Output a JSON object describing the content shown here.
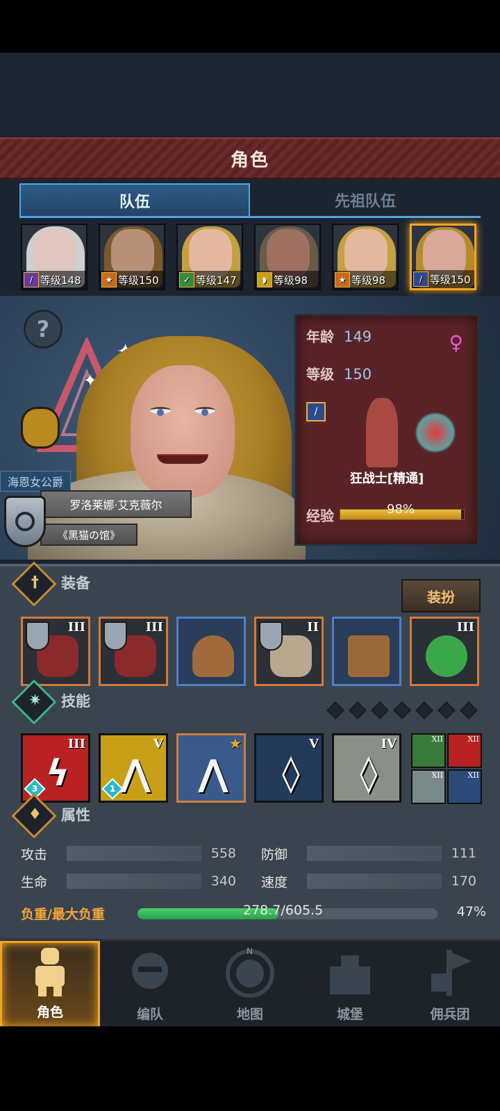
{
  "title": "角色",
  "tabs": {
    "party": "队伍",
    "ancestors": "先祖队伍"
  },
  "roster": [
    {
      "level": "等级148",
      "hair": "#cfcfcf",
      "skin": "#e0c6c0",
      "class_icon": "staff-icon",
      "class_color": "#6a3aa0"
    },
    {
      "level": "等级150",
      "hair": "#7a5a2a",
      "skin": "#b89078",
      "class_icon": "beast-icon",
      "class_color": "#c86a1a"
    },
    {
      "level": "等级147",
      "hair": "#c4a040",
      "skin": "#e4b8a0",
      "class_icon": "bow-icon",
      "class_color": "#3a8a3a"
    },
    {
      "level": "等级98",
      "hair": "#6a5a48",
      "skin": "#a07060",
      "class_icon": "shield-icon",
      "class_color": "#c8a018"
    },
    {
      "level": "等级98",
      "hair": "#c4a040",
      "skin": "#e4b8a0",
      "class_icon": "beast-icon",
      "class_color": "#c86a1a"
    },
    {
      "level": "等级150",
      "hair": "#b88a30",
      "skin": "#d8a898",
      "class_icon": "sword-icon",
      "class_color": "#2d4a8c"
    }
  ],
  "hero": {
    "title_tag": "海恩女公爵",
    "name": "罗洛莱娜·艾克薇尔",
    "guild": "《黑猫の馆》"
  },
  "info": {
    "age_label": "年龄",
    "age": "149",
    "level_label": "等级",
    "level": "150",
    "class_name": "狂战士[精通]",
    "exp_label": "经验",
    "exp_percent": "98%",
    "exp_fraction": 0.98
  },
  "equipment": {
    "label": "装备",
    "outfit_button": "装扮",
    "slots": [
      {
        "tier": "III",
        "border": "orange",
        "shield": true,
        "color": "#8a2a2a"
      },
      {
        "tier": "III",
        "border": "orange",
        "shield": true,
        "color": "#8a2a2a"
      },
      {
        "tier": "",
        "border": "blue",
        "shield": false,
        "color": "#a06a3a"
      },
      {
        "tier": "II",
        "border": "orange",
        "shield": true,
        "color": "#b8a890"
      },
      {
        "tier": "",
        "border": "blue",
        "shield": false,
        "color": "#9a6a3a"
      },
      {
        "tier": "III",
        "border": "orange",
        "shield": false,
        "color": "#3aa84a"
      }
    ]
  },
  "skills": {
    "label": "技能",
    "items": [
      {
        "tier": "III",
        "bg": "#b82222",
        "gem": "3"
      },
      {
        "tier": "V",
        "bg": "#c8a018",
        "gem": "1"
      },
      {
        "tier": "",
        "bg": "#3a5a8a",
        "gem": "",
        "star": "★"
      },
      {
        "tier": "V",
        "bg": "#243a5a",
        "gem": ""
      },
      {
        "tier": "IV",
        "bg": "#8a9088",
        "gem": ""
      }
    ],
    "mini": [
      {
        "tier": "XII",
        "bg": "#3a7a3a"
      },
      {
        "tier": "XII",
        "bg": "#b82222"
      },
      {
        "tier": "XII",
        "bg": "#7a8a88"
      },
      {
        "tier": "XII",
        "bg": "#2a4a7a"
      }
    ]
  },
  "attributes": {
    "label": "属性",
    "attack_label": "攻击",
    "attack": "558",
    "defense_label": "防御",
    "defense": "111",
    "hp_label": "生命",
    "hp": "340",
    "speed_label": "速度",
    "speed": "170",
    "load_label": "负重/最大负重",
    "load": "278.7/605.5",
    "load_percent": "47%",
    "load_fraction": 0.47
  },
  "nav": [
    {
      "label": "角色"
    },
    {
      "label": "编队"
    },
    {
      "label": "地图"
    },
    {
      "label": "城堡"
    },
    {
      "label": "佣兵团"
    }
  ]
}
